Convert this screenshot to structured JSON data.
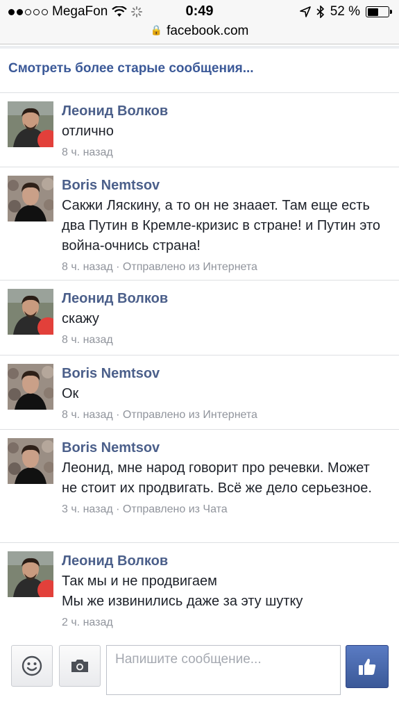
{
  "status_bar": {
    "carrier": "MegaFon",
    "time": "0:49",
    "battery": "52 %",
    "battery_level": 0.52
  },
  "url_bar": {
    "url": "facebook.com"
  },
  "older_link": "Смотреть более старые сообщения...",
  "messages": [
    {
      "author": "Леонид Волков",
      "text": "отлично",
      "time": "8 ч. назад",
      "via": "",
      "avatar": "avatar-volkov"
    },
    {
      "author": "Boris Nemtsov",
      "text": "Сакжи Ляскину, а то он не знаает. Там еще есть два Путин в Кремле-кризис в стране! и Путин это война-очнись страна!",
      "time": "8 ч. назад",
      "via": " · Отправлено из Интернета",
      "avatar": "avatar-nemtsov"
    },
    {
      "author": "Леонид Волков",
      "text": "скажу",
      "time": "8 ч. назад",
      "via": "",
      "avatar": "avatar-volkov"
    },
    {
      "author": "Boris Nemtsov",
      "text": "Ок",
      "time": "8 ч. назад",
      "via": " · Отправлено из Интернета",
      "avatar": "avatar-nemtsov"
    },
    {
      "author": "Boris Nemtsov",
      "text": "Леонид, мне народ говорит про речевки. Может не стоит их продвигать. Всё же дело серьезное.",
      "time": "3 ч. назад",
      "via": " · Отправлено из Чата",
      "avatar": "avatar-nemtsov"
    },
    {
      "author": "Леонид Волков",
      "text": "Так мы и не продвигаем\nМы же извинились даже за эту шутку",
      "time": "2 ч. назад",
      "via": "",
      "avatar": "avatar-volkov"
    }
  ],
  "composer": {
    "placeholder": "Напишите сообщение...",
    "emoji_icon": "emoji-icon",
    "camera_icon": "camera-icon",
    "like_icon": "thumbs-up-icon"
  },
  "colors": {
    "fb_blue": "#3b5998",
    "author": "#4b5f8a",
    "meta": "#90949c"
  }
}
